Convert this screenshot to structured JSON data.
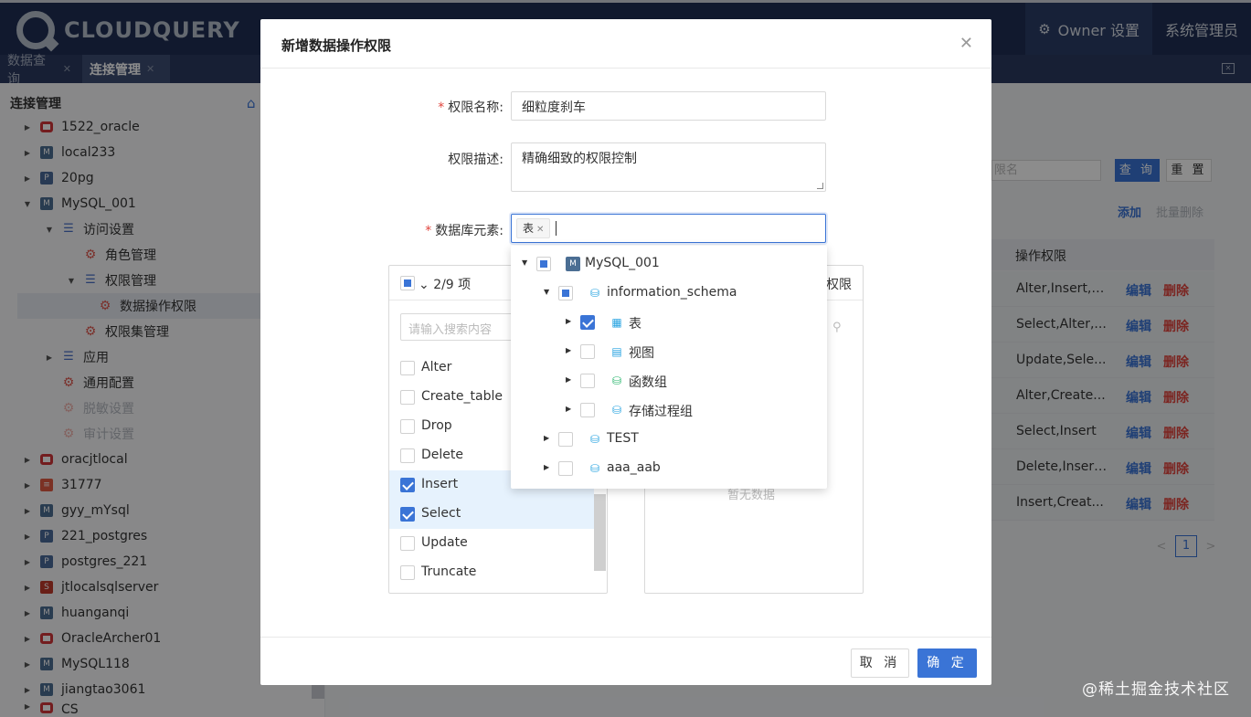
{
  "app": {
    "logo_text": "CLOUDQUERY",
    "nav": [
      {
        "label": "Owner 设置",
        "active": true
      },
      {
        "label": "系统管理员",
        "active": false
      }
    ],
    "tabs": [
      {
        "label": "数据查询",
        "active": false
      },
      {
        "label": "连接管理",
        "active": true
      }
    ]
  },
  "sidebar": {
    "title": "连接管理",
    "items": [
      {
        "label": "1522_oracle",
        "icon": "oracle-icon"
      },
      {
        "label": "local233",
        "icon": "mysql-icon"
      },
      {
        "label": "20pg",
        "icon": "postgres-icon"
      },
      {
        "label": "MySQL_001",
        "icon": "mysql-icon"
      },
      {
        "label": "访问设置",
        "icon": "list-icon"
      },
      {
        "label": "角色管理",
        "icon": "gear-icon"
      },
      {
        "label": "权限管理",
        "icon": "list-icon"
      },
      {
        "label": "数据操作权限",
        "icon": "gear-icon"
      },
      {
        "label": "权限集管理",
        "icon": "gear-icon"
      },
      {
        "label": "应用",
        "icon": "list-icon"
      },
      {
        "label": "通用配置",
        "icon": "gear-icon"
      },
      {
        "label": "脱敏设置",
        "icon": "gear-icon"
      },
      {
        "label": "审计设置",
        "icon": "gear-icon"
      },
      {
        "label": "oracjtlocal",
        "icon": "oracle-icon"
      },
      {
        "label": "31777",
        "icon": "stack-icon"
      },
      {
        "label": "gyy_mYsql",
        "icon": "mysql-icon"
      },
      {
        "label": "221_postgres",
        "icon": "postgres-icon"
      },
      {
        "label": "postgres_221",
        "icon": "postgres-icon"
      },
      {
        "label": "jtlocalsqlserver",
        "icon": "sqlserver-icon"
      },
      {
        "label": "huanganqi",
        "icon": "mysql-icon"
      },
      {
        "label": "OracleArcher01",
        "icon": "oracle-icon"
      },
      {
        "label": "MySQL118",
        "icon": "mysql-icon"
      },
      {
        "label": "jiangtao3061",
        "icon": "mysql-icon"
      },
      {
        "label": "CS",
        "icon": "oracle-icon"
      }
    ]
  },
  "main": {
    "filter_placeholder": "限名",
    "query_button": "查 询",
    "reset_button": "重 置",
    "add_link": "添加",
    "bulk_delete_link": "批量删除",
    "column_header": "操作权限",
    "edit_label": "编辑",
    "delete_label": "删除",
    "rows": [
      "Alter,Insert,S...",
      "Select,Alter,...",
      "Update,Sele...",
      "Alter,Create...",
      "Select,Insert",
      "Delete,Insert...",
      "Insert,Creat..."
    ],
    "current_page": "1",
    "watermark": "@稀土掘金技术社区"
  },
  "modal": {
    "title": "新增数据操作权限",
    "name_label": "权限名称:",
    "name_value": "细粒度刹车",
    "desc_label": "权限描述:",
    "desc_value": "精确细致的权限控制",
    "element_label": "数据库元素:",
    "selected_tag": "表",
    "transfer": {
      "left_count": "2/9 项",
      "search_placeholder": "请输入搜索内容",
      "items": [
        {
          "label": "Alter",
          "checked": false
        },
        {
          "label": "Create_table",
          "checked": false
        },
        {
          "label": "Drop",
          "checked": false
        },
        {
          "label": "Delete",
          "checked": false
        },
        {
          "label": "Insert",
          "checked": true
        },
        {
          "label": "Select",
          "checked": true
        },
        {
          "label": "Update",
          "checked": false
        },
        {
          "label": "Truncate",
          "checked": false
        }
      ],
      "right_title": "权限",
      "right_empty": "暂无数据"
    },
    "tree": [
      {
        "label": "MySQL_001",
        "state": "partial",
        "expanded": true
      },
      {
        "label": "information_schema",
        "state": "partial",
        "expanded": true
      },
      {
        "label": "表",
        "state": "checked",
        "expanded": false
      },
      {
        "label": "视图",
        "state": "unchecked",
        "expanded": false
      },
      {
        "label": "函数组",
        "state": "unchecked",
        "expanded": false
      },
      {
        "label": "存储过程组",
        "state": "unchecked",
        "expanded": false
      },
      {
        "label": "TEST",
        "state": "unchecked",
        "expanded": false
      },
      {
        "label": "aaa_aab",
        "state": "unchecked",
        "expanded": false
      }
    ],
    "cancel_button": "取 消",
    "ok_button": "确 定"
  },
  "colors": {
    "primary": "#3a74d6",
    "danger": "#e0443c",
    "topbar": "#1f2f54"
  }
}
